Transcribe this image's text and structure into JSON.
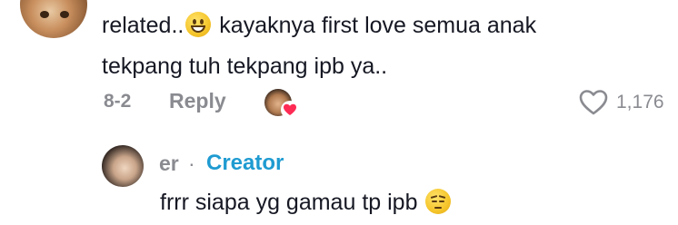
{
  "comment": {
    "line1_pre": "related..",
    "line1_post": " kayaknya first love semua anak",
    "line2": "tekpang tuh tekpang ipb ya..",
    "emoji_icon": "grinning-face-icon",
    "date": "8-2",
    "reply_label": "Reply",
    "like_count": "1,176",
    "like_icon": "heart-outline-icon"
  },
  "reply": {
    "author": "er",
    "separator": "·",
    "badge": "Creator",
    "text": "frrr siapa yg gamau tp ipb ",
    "emoji_icon": "pensive-face-icon"
  },
  "colors": {
    "primary_text": "#161823",
    "secondary_text": "#8a8b91",
    "creator_badge": "#1f9bd1",
    "heart_badge": "#fe2c55"
  }
}
